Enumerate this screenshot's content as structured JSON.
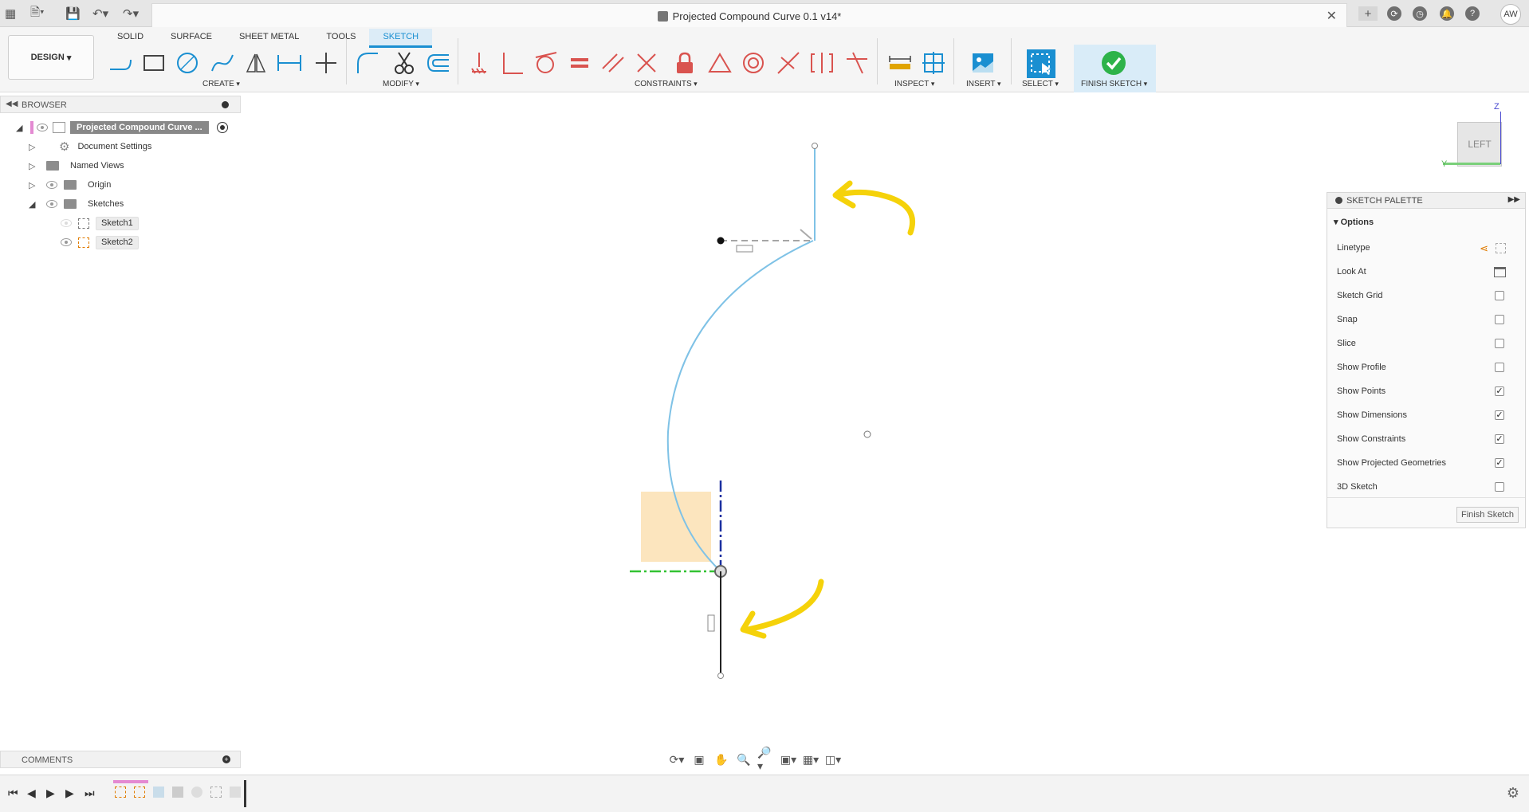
{
  "app": {
    "document_title": "Projected Compound Curve 0.1 v14*",
    "user_initials": "AW"
  },
  "ribbon": {
    "workspace": "DESIGN",
    "tabs": [
      "SOLID",
      "SURFACE",
      "SHEET METAL",
      "TOOLS",
      "SKETCH"
    ],
    "active_tab": "SKETCH",
    "groups": {
      "create": "CREATE",
      "modify": "MODIFY",
      "constraints": "CONSTRAINTS",
      "inspect": "INSPECT",
      "insert": "INSERT",
      "select": "SELECT",
      "finish": "FINISH SKETCH"
    },
    "colors": {
      "accent": "#1a8fd1",
      "finish_green": "#2db34a",
      "constraint_red": "#d9534f"
    }
  },
  "browser": {
    "title": "BROWSER",
    "root": "Projected Compound Curve ...",
    "items": [
      {
        "label": "Document Settings",
        "icon": "gear-icon"
      },
      {
        "label": "Named Views",
        "icon": "folder-icon"
      },
      {
        "label": "Origin",
        "icon": "folder-icon"
      },
      {
        "label": "Sketches",
        "icon": "folder-icon"
      }
    ],
    "sketches": [
      "Sketch1",
      "Sketch2"
    ]
  },
  "comments": {
    "title": "COMMENTS"
  },
  "viewcube": {
    "face": "LEFT",
    "axis_z": "Z",
    "axis_y": "Y"
  },
  "palette": {
    "title": "SKETCH PALETTE",
    "section": "Options",
    "options": [
      {
        "label": "Linetype",
        "type": "icons"
      },
      {
        "label": "Look At",
        "type": "icon"
      },
      {
        "label": "Sketch Grid",
        "checked": false
      },
      {
        "label": "Snap",
        "checked": false
      },
      {
        "label": "Slice",
        "checked": false
      },
      {
        "label": "Show Profile",
        "checked": false
      },
      {
        "label": "Show Points",
        "checked": true
      },
      {
        "label": "Show Dimensions",
        "checked": true
      },
      {
        "label": "Show Constraints",
        "checked": true
      },
      {
        "label": "Show Projected Geometries",
        "checked": true
      },
      {
        "label": "3D Sketch",
        "checked": false
      }
    ],
    "finish_button": "Finish Sketch"
  }
}
